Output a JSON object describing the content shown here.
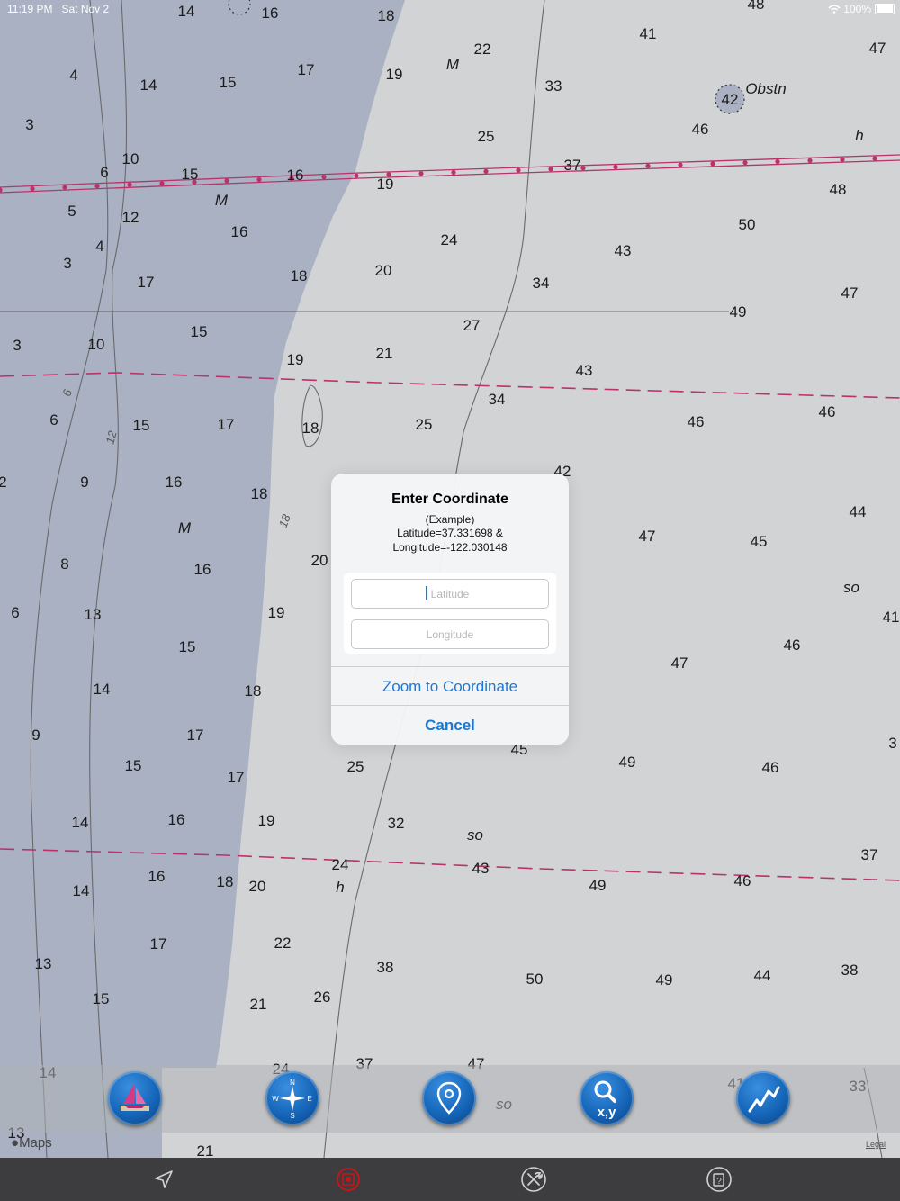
{
  "status_bar": {
    "time": "11:19 PM",
    "date": "Sat Nov 2",
    "battery": "100%"
  },
  "chart": {
    "soundings": [
      "14",
      "16",
      "18",
      "48",
      "41",
      "47",
      "4",
      "14",
      "15",
      "17",
      "19",
      "22",
      "33",
      "42",
      "3",
      "25",
      "46",
      "10",
      "6",
      "15",
      "16",
      "37",
      "19",
      "48",
      "5",
      "12",
      "16",
      "24",
      "50",
      "43",
      "4",
      "3",
      "17",
      "18",
      "20",
      "34",
      "47",
      "49",
      "27",
      "15",
      "10",
      "3",
      "19",
      "21",
      "43",
      "34",
      "6",
      "15",
      "17",
      "18",
      "25",
      "46",
      "46",
      "42",
      "9",
      "16",
      "18",
      "44",
      "47",
      "45",
      "8",
      "16",
      "20",
      "6",
      "13",
      "19",
      "46",
      "15",
      "14",
      "18",
      "47",
      "9",
      "17",
      "45",
      "49",
      "46",
      "15",
      "17",
      "25",
      "14",
      "16",
      "19",
      "32",
      "37",
      "16",
      "18",
      "24",
      "43",
      "46",
      "14",
      "20",
      "49",
      "22",
      "17",
      "13",
      "38",
      "50",
      "49",
      "44",
      "38",
      "15",
      "21",
      "26",
      "14",
      "24",
      "37",
      "47",
      "33",
      "21",
      "13",
      "41",
      "41",
      "3",
      "2"
    ],
    "labels": [
      "M",
      "M",
      "M",
      "Obstn",
      "h",
      "so",
      "so",
      "h",
      "so"
    ],
    "contours": [
      "6",
      "12",
      "18"
    ]
  },
  "dialog": {
    "title": "Enter Coordinate",
    "example_line": "(Example)",
    "latitude_example": "Latitude=37.331698 &",
    "longitude_example": "Longitude=-122.030148",
    "latitude_placeholder": "Latitude",
    "longitude_placeholder": "Longitude",
    "zoom_button": "Zoom to Coordinate",
    "cancel_button": "Cancel"
  },
  "toolbar": {
    "buttons": [
      "sailboat-icon",
      "compass-icon",
      "location-pin-icon",
      "search-xy-icon",
      "track-graph-icon"
    ],
    "xy_label": "x,y"
  },
  "map_credit": "Maps",
  "legal": "Legal",
  "tab_bar": {
    "icons": [
      "navigate-arrow-icon",
      "record-icon",
      "tools-icon",
      "help-icon"
    ],
    "record_color": "#c01818"
  },
  "colors": {
    "land": "#a9b1c2",
    "water": "#d2d3d5",
    "route_magenta": "#b9336b",
    "accent": "#1b78d6"
  }
}
